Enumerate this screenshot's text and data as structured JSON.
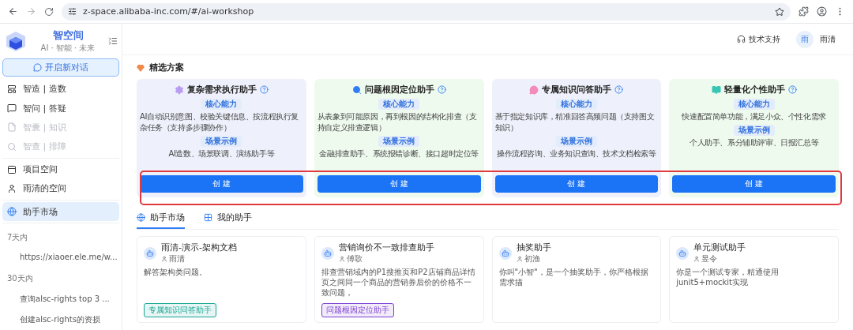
{
  "browser": {
    "url": "z-space.alibaba-inc.com/#/ai-workshop"
  },
  "sidebar": {
    "brand": {
      "name": "智空间",
      "slogan": "AI · 智能 · 未来"
    },
    "new_chat": "开启新对话",
    "groups": [
      [
        {
          "label": "智造 | 造数",
          "kind": "build",
          "disabled": false,
          "selected": false
        },
        {
          "label": "智问 | 答疑",
          "kind": "ask",
          "disabled": false,
          "selected": false
        },
        {
          "label": "智囊 | 知识",
          "kind": "file",
          "disabled": true,
          "selected": false
        },
        {
          "label": "智查 | 排障",
          "kind": "search",
          "disabled": true,
          "selected": false
        }
      ],
      [
        {
          "label": "项目空间",
          "kind": "project",
          "disabled": false,
          "selected": false
        },
        {
          "label": "雨清的空间",
          "kind": "user",
          "disabled": false,
          "selected": false
        }
      ],
      [
        {
          "label": "助手市场",
          "kind": "market",
          "disabled": false,
          "selected": true
        }
      ]
    ],
    "history": [
      {
        "group": "7天内",
        "items": [
          "https://xiaoer.ele.me/w..."
        ]
      },
      {
        "group": "30天内",
        "items": [
          "查询alsc-rights top 3 ...",
          "创建alsc-rights的资损"
        ]
      }
    ]
  },
  "header": {
    "support": "技术支持",
    "user": {
      "avatar": "雨",
      "name": "雨清"
    }
  },
  "featured": {
    "title": "精选方案",
    "cards": [
      {
        "title": "复杂需求执行助手",
        "kind": "gear",
        "color": "#b99cf2",
        "capability_label": "核心能力",
        "capability": "AI自动识别意图、校验关键信息、按流程执行复杂任务（支持多步骤协作）",
        "scene_label": "场景示例",
        "scene": "AI造数、场景联调、演练助手等",
        "button": "创 建"
      },
      {
        "title": "问题根因定位助手",
        "kind": "search",
        "color": "#2f7cf6",
        "capability_label": "核心能力",
        "capability": "从表象到可能原因，再到根因的结构化排查（支持自定义排查逻辑）",
        "scene_label": "场景示例",
        "scene": "金融排查助手、系统报错诊断、接口超时定位等",
        "button": "创 建"
      },
      {
        "title": "专属知识问答助手",
        "kind": "chat",
        "color": "#f28cb8",
        "capability_label": "核心能力",
        "capability": "基于指定知识库，精准回答高频问题（支持图文知识）",
        "scene_label": "场景示例",
        "scene": "操作流程咨询、业务知识查询、技术文档检索等",
        "button": "创 建"
      },
      {
        "title": "轻量化个性助手",
        "kind": "book",
        "color": "#38c6b4",
        "capability_label": "核心能力",
        "capability": "快速配置简单功能，满足小众、个性化需求",
        "scene_label": "场景示例",
        "scene": "个人助手、系分辅助评审、日报汇总等",
        "button": "创 建"
      }
    ]
  },
  "tabs": [
    {
      "label": "助手市场",
      "kind": "globe",
      "selected": true
    },
    {
      "label": "我的助手",
      "kind": "grid",
      "selected": false
    }
  ],
  "market": [
    {
      "title": "雨清-演示-架构文档",
      "author": "雨清",
      "description": "解答架构类问题。",
      "tag": {
        "label": "专属知识问答助手",
        "color": "#17a594"
      }
    },
    {
      "title": "营销询价不一致排查助手",
      "author": "傅歌",
      "description": "排查营销域内的P1搜推页和P2店铺商品详情页之间同一个商品的营销券后价的价格不一致问题，",
      "tag": {
        "label": "问题根因定位助手",
        "color": "#7b3fd1"
      }
    },
    {
      "title": "抽奖助手",
      "author": "初渔",
      "description": "你叫\"小智\"，是一个抽奖助手，你严格根据需求描"
    },
    {
      "title": "单元测试助手",
      "author": "昱令",
      "description": "你是一个测试专家，精通使用junit5+mockit实现"
    }
  ]
}
